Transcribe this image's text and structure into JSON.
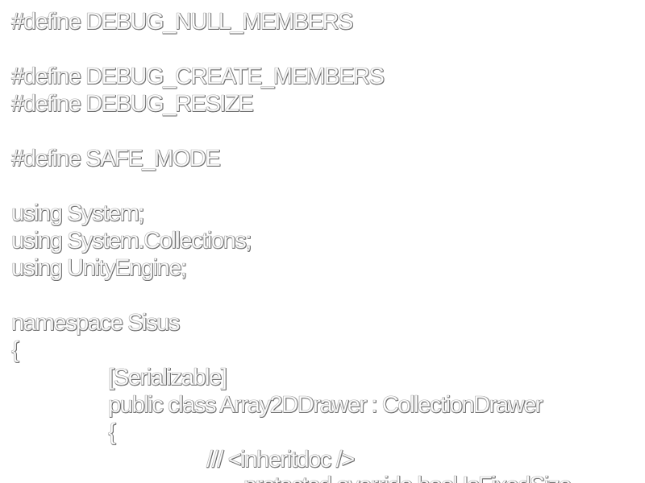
{
  "document": {
    "lines": [
      "#define DEBUG_NULL_MEMBERS",
      "",
      "#define DEBUG_CREATE_MEMBERS",
      "#define DEBUG_RESIZE",
      "",
      "#define SAFE_MODE",
      "",
      "using System;",
      "using System.Collections;",
      "using UnityEngine;",
      "",
      "namespace Sisus",
      "{",
      "[Serializable]",
      "public class Array2DDrawer : CollectionDrawer",
      "{",
      "/// <inheritdoc />",
      "protected override bool IsFixedSize"
    ]
  }
}
